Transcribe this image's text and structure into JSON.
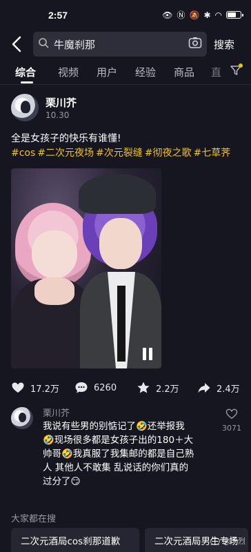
{
  "status": {
    "time": "2:57"
  },
  "search": {
    "query": "牛魔刹那",
    "submit_label": "搜索"
  },
  "tabs": [
    {
      "label": "综合"
    },
    {
      "label": "视频"
    },
    {
      "label": "用户"
    },
    {
      "label": "经验"
    },
    {
      "label": "商品"
    },
    {
      "label": "直"
    }
  ],
  "post": {
    "author": "栗川芥",
    "date": "10.30",
    "text": "全是女孩子的快乐有谁懂!",
    "hashtags": [
      "#cos",
      "#二次元夜场",
      "#次元裂缝",
      "#彻夜之歌",
      "#七草荠"
    ],
    "likes": "17.2万",
    "comments": "6260",
    "favorites": "2.2万",
    "shares": "2.4万"
  },
  "top_comment": {
    "author": "栗川芥",
    "text_lines": [
      "我说有些男的别惦记了🤣还举报我",
      "🤣现场很多都是女孩子出的180＋大",
      "帅哥🤣我真服了我集邮的都是自己熟",
      "人 其他人不敢集 乱说话的你们真的",
      "过分了😏"
    ],
    "likes": "3071"
  },
  "related": {
    "title": "大家都在搜",
    "chips": [
      "二次元酒局cos刹那道歉",
      "二次元酒局男生专场"
    ]
  },
  "watermark": "@严烈"
}
